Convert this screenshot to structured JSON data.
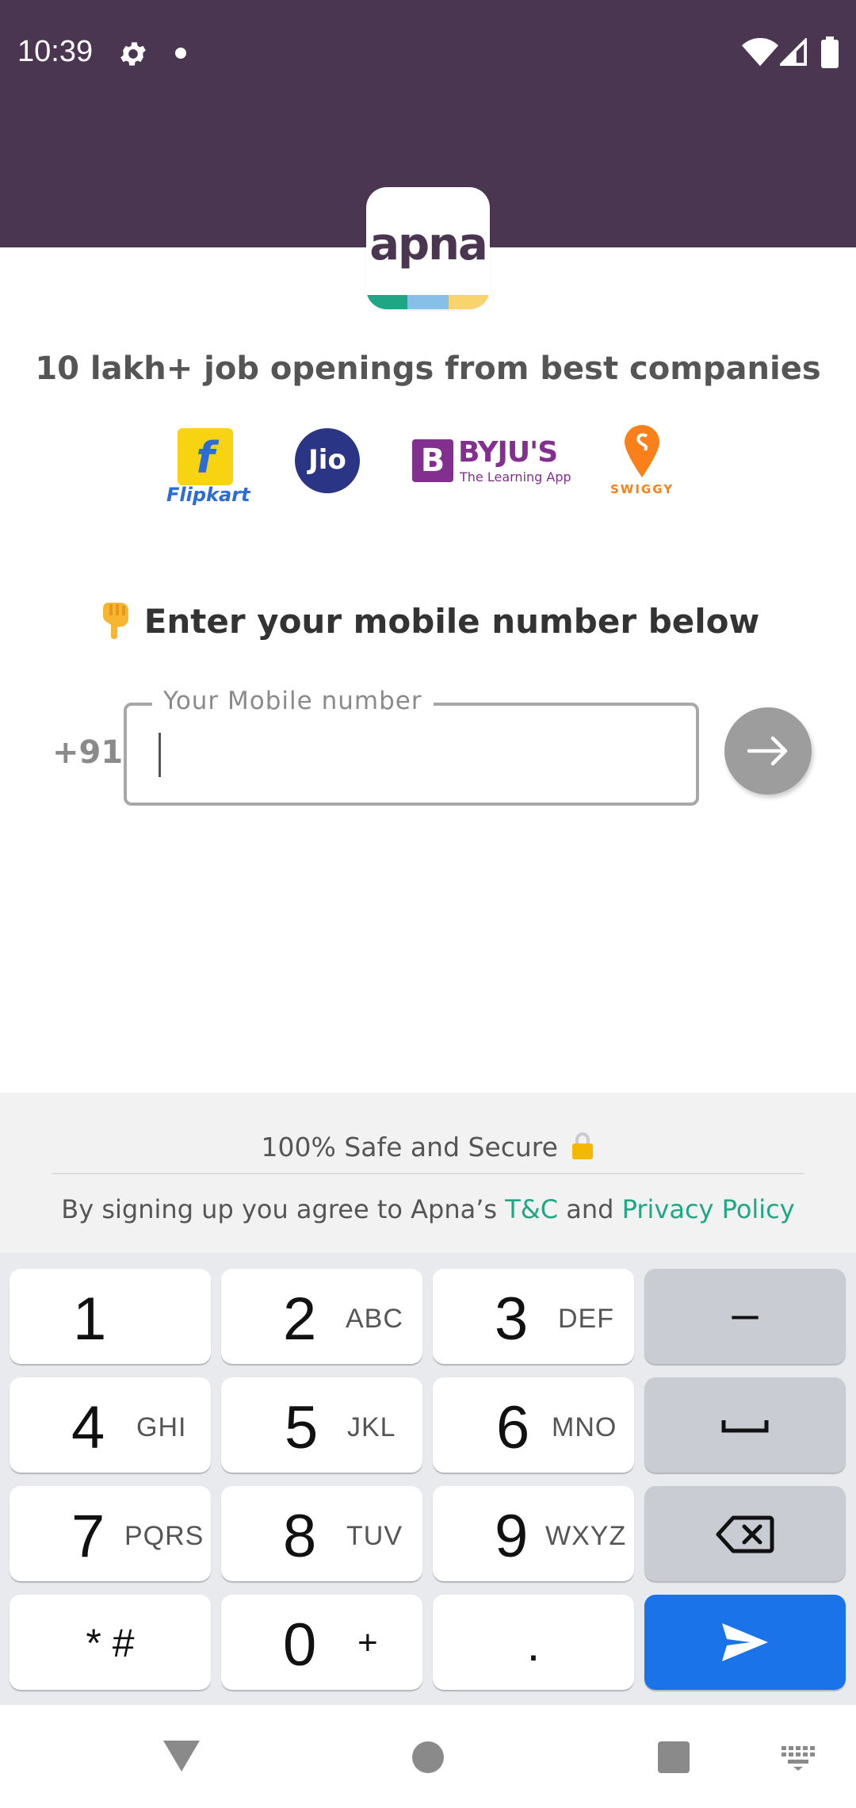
{
  "status_bar": {
    "time": "10:39",
    "icons": [
      "gear-icon",
      "notification-dot-icon",
      "wifi-icon",
      "cell-signal-icon",
      "battery-icon"
    ]
  },
  "brand": {
    "logo_text": "apna",
    "primary_color": "#4b3651",
    "stripe_colors": [
      "#1fa785",
      "#86bfe8",
      "#f9d36b"
    ]
  },
  "tagline": "10 lakh+ job openings from best companies",
  "companies": [
    {
      "name": "Flipkart",
      "mark": "f"
    },
    {
      "name": "Jio"
    },
    {
      "name": "BYJU'S",
      "mark": "B",
      "subtitle": "The Learning App"
    },
    {
      "name": "SWIGGY"
    }
  ],
  "prompt": {
    "emoji": "pointing-down-hand-icon",
    "text": "Enter your mobile number below"
  },
  "mobile_input": {
    "country_code": "+91",
    "label": "Your Mobile number",
    "value": "",
    "submit_icon": "arrow-right-icon"
  },
  "footer": {
    "safe_text": "100% Safe and Secure",
    "terms_prefix": "By signing up you agree to Apna’s ",
    "terms_link": "T&C",
    "terms_and": " and ",
    "privacy_link": "Privacy Policy",
    "link_color": "#1fa785"
  },
  "keyboard": {
    "rows": [
      [
        {
          "num": "1",
          "sub": ""
        },
        {
          "num": "2",
          "sub": "ABC"
        },
        {
          "num": "3",
          "sub": "DEF"
        }
      ],
      [
        {
          "num": "4",
          "sub": "GHI"
        },
        {
          "num": "5",
          "sub": "JKL"
        },
        {
          "num": "6",
          "sub": "MNO"
        }
      ],
      [
        {
          "num": "7",
          "sub": "PQRS"
        },
        {
          "num": "8",
          "sub": "TUV"
        },
        {
          "num": "9",
          "sub": "WXYZ"
        }
      ]
    ],
    "minus": "–",
    "symbols": "* #",
    "zero": "0",
    "plus": "+",
    "period": ".",
    "enter_color": "#1a73e8"
  },
  "nav_bar": {
    "icons": [
      "back-icon",
      "home-icon",
      "recents-icon",
      "keyboard-switch-icon"
    ]
  }
}
